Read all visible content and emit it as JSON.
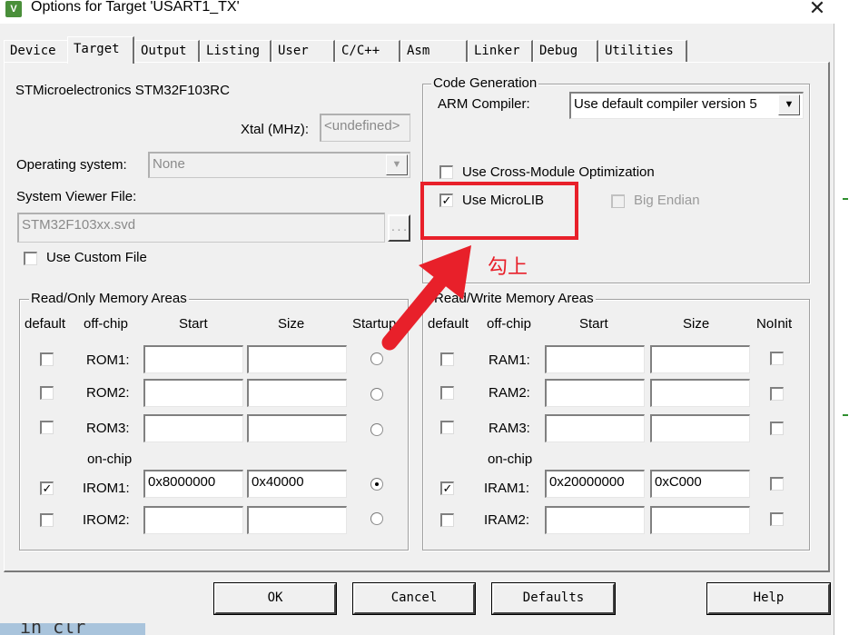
{
  "window": {
    "title": "Options for Target 'USART1_TX'",
    "icon_name": "keil-uvision-icon",
    "close_glyph": "✕"
  },
  "tabs": [
    {
      "label": "Device"
    },
    {
      "label": "Target",
      "active": true
    },
    {
      "label": "Output"
    },
    {
      "label": "Listing"
    },
    {
      "label": "User"
    },
    {
      "label": "C/C++"
    },
    {
      "label": "Asm"
    },
    {
      "label": "Linker"
    },
    {
      "label": "Debug"
    },
    {
      "label": "Utilities"
    }
  ],
  "device": {
    "name": "STMicroelectronics STM32F103RC",
    "xtal_label": "Xtal (MHz):",
    "xtal_value": "<undefined>",
    "os_label": "Operating system:",
    "os_value": "None",
    "svd_label": "System Viewer File:",
    "svd_value": "STM32F103xx.svd",
    "browse_label": "...",
    "use_custom_file_label": "Use Custom File",
    "use_custom_file_checked": false
  },
  "code_generation": {
    "title": "Code Generation",
    "arm_compiler_label": "ARM Compiler:",
    "arm_compiler_value": "Use default compiler version 5",
    "cross_module_label": "Use Cross-Module Optimization",
    "cross_module_checked": false,
    "microlib_label": "Use MicroLIB",
    "microlib_checked": true,
    "big_endian_label": "Big Endian",
    "big_endian_checked": false
  },
  "annotation": {
    "text": "勾上",
    "color": "#e8202a"
  },
  "readonly_memory": {
    "title": "Read/Only Memory Areas",
    "headers": {
      "default": "default",
      "offchip": "off-chip",
      "start": "Start",
      "size": "Size",
      "startup": "Startup"
    },
    "onchip_label": "on-chip",
    "rows": [
      {
        "name": "ROM1:",
        "default": false,
        "start": "",
        "size": "",
        "startup": false
      },
      {
        "name": "ROM2:",
        "default": false,
        "start": "",
        "size": "",
        "startup": false
      },
      {
        "name": "ROM3:",
        "default": false,
        "start": "",
        "size": "",
        "startup": false
      },
      {
        "name": "IROM1:",
        "default": true,
        "start": "0x8000000",
        "size": "0x40000",
        "startup": true
      },
      {
        "name": "IROM2:",
        "default": false,
        "start": "",
        "size": "",
        "startup": false
      }
    ]
  },
  "readwrite_memory": {
    "title": "Read/Write Memory Areas",
    "headers": {
      "default": "default",
      "offchip": "off-chip",
      "start": "Start",
      "size": "Size",
      "noinit": "NoInit"
    },
    "onchip_label": "on-chip",
    "rows": [
      {
        "name": "RAM1:",
        "default": false,
        "start": "",
        "size": "",
        "noinit": false
      },
      {
        "name": "RAM2:",
        "default": false,
        "start": "",
        "size": "",
        "noinit": false
      },
      {
        "name": "RAM3:",
        "default": false,
        "start": "",
        "size": "",
        "noinit": false
      },
      {
        "name": "IRAM1:",
        "default": true,
        "start": "0x20000000",
        "size": "0xC000",
        "noinit": false
      },
      {
        "name": "IRAM2:",
        "default": false,
        "start": "",
        "size": "",
        "noinit": false
      }
    ]
  },
  "buttons": {
    "ok": "OK",
    "cancel": "Cancel",
    "defaults": "Defaults",
    "help": "Help"
  },
  "background_text": "in clr"
}
